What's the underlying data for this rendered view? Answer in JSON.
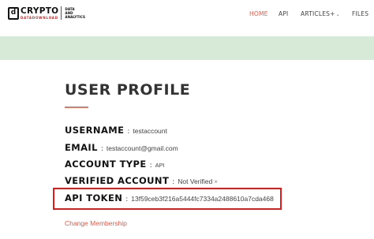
{
  "brand": {
    "logo_letter": "d",
    "name": "CRYPTO",
    "sub": "DATADOWNLOAD",
    "tagline": [
      "DATA",
      "AND",
      "ANALYTICS"
    ]
  },
  "nav": {
    "items": [
      {
        "label": "HOME",
        "active": true
      },
      {
        "label": "API"
      },
      {
        "label": "ARTICLES+",
        "dropdown": true
      },
      {
        "label": "FILES"
      }
    ],
    "dropdown_icon": "chevron-down-icon"
  },
  "colors": {
    "accent": "#e05a4a",
    "banner": "#d7ead7",
    "highlight_border": "#e01b1b"
  },
  "profile": {
    "title": "USER PROFILE",
    "fields": [
      {
        "label": "USERNAME",
        "value": "testaccount"
      },
      {
        "label": "EMAIL",
        "value": "testaccount@gmail.com"
      },
      {
        "label": "ACCOUNT TYPE",
        "value": "API"
      },
      {
        "label": "VERIFIED ACCOUNT",
        "value": "Not Verified",
        "icon": "x-icon"
      },
      {
        "label": "API TOKEN",
        "value": "13f59ceb3f216a5444fc7334a2488610a7cda468"
      }
    ],
    "colon": ":",
    "change_link": "Change Membership"
  }
}
